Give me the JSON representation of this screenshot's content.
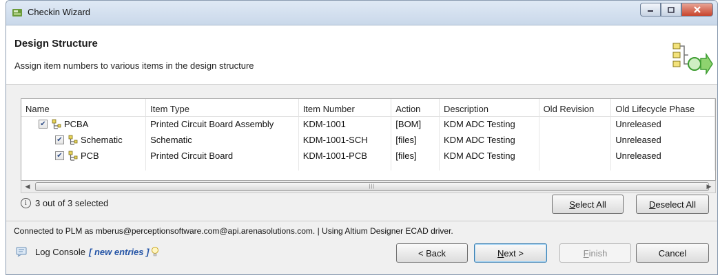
{
  "window": {
    "title": "Checkin Wizard"
  },
  "header": {
    "title": "Design Structure",
    "description": "Assign item numbers to various items in the design structure"
  },
  "table": {
    "columns": [
      "Name",
      "Item Type",
      "Item Number",
      "Action",
      "Description",
      "Old Revision",
      "Old Lifecycle Phase"
    ],
    "rows": [
      {
        "checked": true,
        "name": "PCBA",
        "item_type": "Printed Circuit Board Assembly",
        "item_number": "KDM-1001",
        "action": "[BOM]",
        "description": "KDM ADC Testing",
        "old_revision": "",
        "old_lifecycle_phase": "Unreleased"
      },
      {
        "checked": true,
        "name": "Schematic",
        "item_type": "Schematic",
        "item_number": "KDM-1001-SCH",
        "action": "[files]",
        "description": "KDM ADC Testing",
        "old_revision": "",
        "old_lifecycle_phase": "Unreleased"
      },
      {
        "checked": true,
        "name": "PCB",
        "item_type": "Printed Circuit Board",
        "item_number": "KDM-1001-PCB",
        "action": "[files]",
        "description": "KDM ADC Testing",
        "old_revision": "",
        "old_lifecycle_phase": "Unreleased"
      }
    ]
  },
  "selection": {
    "info_symbol": "i",
    "status_text": "3 out of 3 selected"
  },
  "buttons": {
    "select_all": "Select All",
    "deselect_all": "Deselect All",
    "back": "< Back",
    "next": "Next >",
    "finish": "Finish",
    "cancel": "Cancel"
  },
  "footer": {
    "connection_text": "Connected to PLM as mberus@perceptionsoftware.com@api.arenasolutions.com.  |  Using Altium Designer ECAD driver.",
    "log_console_label": "Log Console",
    "new_entries_label": "[ new entries ]"
  },
  "icons": {
    "app": "wizard-app-icon",
    "header_graphic": "structure-arrow-icon",
    "node": "tree-node-icon",
    "console": "log-console-icon",
    "bulb": "lightbulb-icon"
  },
  "colors": {
    "accent": "#3c7fb1",
    "link": "#2454a6",
    "close_button": "#c8442c"
  }
}
